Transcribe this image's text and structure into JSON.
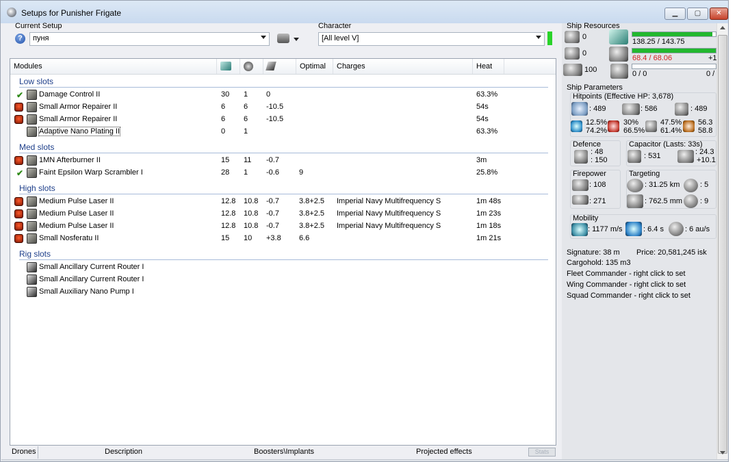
{
  "window": {
    "title": "Setups for Punisher Frigate"
  },
  "setup": {
    "label": "Current Setup",
    "value": "пуня"
  },
  "character": {
    "label": "Character",
    "value": "[All level V]"
  },
  "modules": {
    "columns": [
      "Modules",
      "Optimal",
      "Charges",
      "Heat"
    ],
    "sections": [
      {
        "name": "Low slots",
        "items": [
          {
            "state": "check",
            "name": "Damage Control II",
            "c1": "30",
            "c2": "1",
            "c3": "0",
            "optimal": "",
            "charge": "",
            "heat": "63.3%"
          },
          {
            "state": "fire",
            "name": "Small Armor Repairer II",
            "c1": "6",
            "c2": "6",
            "c3": "-10.5",
            "optimal": "",
            "charge": "",
            "heat": "54s"
          },
          {
            "state": "fire",
            "name": "Small Armor Repairer II",
            "c1": "6",
            "c2": "6",
            "c3": "-10.5",
            "optimal": "",
            "charge": "",
            "heat": "54s"
          },
          {
            "state": "none",
            "name": "Adaptive Nano Plating II",
            "c1": "0",
            "c2": "1",
            "c3": "",
            "optimal": "",
            "charge": "",
            "heat": "63.3%"
          }
        ]
      },
      {
        "name": "Med slots",
        "items": [
          {
            "state": "fire",
            "name": "1MN Afterburner II",
            "c1": "15",
            "c2": "11",
            "c3": "-0.7",
            "optimal": "",
            "charge": "",
            "heat": "3m"
          },
          {
            "state": "check",
            "name": "Faint Epsilon Warp Scrambler I",
            "c1": "28",
            "c2": "1",
            "c3": "-0.6",
            "optimal": "9",
            "charge": "",
            "heat": "25.8%"
          }
        ]
      },
      {
        "name": "High slots",
        "items": [
          {
            "state": "fire",
            "name": "Medium Pulse Laser II",
            "c1": "12.8",
            "c2": "10.8",
            "c3": "-0.7",
            "optimal": "3.8+2.5",
            "charge": "Imperial Navy Multifrequency S",
            "heat": "1m 48s"
          },
          {
            "state": "fire",
            "name": "Medium Pulse Laser II",
            "c1": "12.8",
            "c2": "10.8",
            "c3": "-0.7",
            "optimal": "3.8+2.5",
            "charge": "Imperial Navy Multifrequency S",
            "heat": "1m 23s"
          },
          {
            "state": "fire",
            "name": "Medium Pulse Laser II",
            "c1": "12.8",
            "c2": "10.8",
            "c3": "-0.7",
            "optimal": "3.8+2.5",
            "charge": "Imperial Navy Multifrequency S",
            "heat": "1m 18s"
          },
          {
            "state": "fire",
            "name": "Small Nosferatu II",
            "c1": "15",
            "c2": "10",
            "c3": "+3.8",
            "optimal": "6.6",
            "charge": "",
            "heat": "1m 21s"
          }
        ]
      },
      {
        "name": "Rig slots",
        "items": [
          {
            "state": "rig",
            "name": "Small Ancillary Current Router I",
            "c1": "",
            "c2": "",
            "c3": "",
            "optimal": "",
            "charge": "",
            "heat": ""
          },
          {
            "state": "rig",
            "name": "Small Ancillary Current Router I",
            "c1": "",
            "c2": "",
            "c3": "",
            "optimal": "",
            "charge": "",
            "heat": ""
          },
          {
            "state": "rig",
            "name": "Small Auxiliary Nano Pump I",
            "c1": "",
            "c2": "",
            "c3": "",
            "optimal": "",
            "charge": "",
            "heat": ""
          }
        ]
      }
    ]
  },
  "bottom_tabs": [
    "Drones",
    "Description",
    "Boosters\\Implants",
    "Projected effects",
    "Stats"
  ],
  "resources": {
    "title": "Ship Resources",
    "turret": "0",
    "launcher": "0",
    "drone_bw": "100",
    "cpu": "138.25 / 143.75",
    "cpu_fill": 0.96,
    "pg": "68.4 / 68.06",
    "pg_fill": 1.0,
    "pg_extra": "+1",
    "calib": "0 / 0",
    "calib_extra": "0 /"
  },
  "params": {
    "title": "Ship Parameters",
    "hp_title": "Hitpoints (Effective HP: 3,678)",
    "shield_hp": ": 489",
    "armor_hp": ": 586",
    "hull_hp": ": 489",
    "res": [
      "12.5%",
      "74.2%",
      "30%",
      "66.5%",
      "47.5%",
      "61.4%",
      "56.3",
      "58.8"
    ],
    "defence_title": "Defence",
    "def1": ": 48",
    "def2": ": 150",
    "cap_title": "Capacitor (Lasts: 33s)",
    "cap_amount": ": 531",
    "cap_recharge": ": 24.3",
    "cap_delta": "+10.1",
    "fire_title": "Firepower",
    "dps": ": 108",
    "volley": ": 271",
    "target_title": "Targeting",
    "range": ": 31.25 km",
    "targets": ": 5",
    "scan": ": 762.5 mm",
    "sensor": ": 9",
    "mobility_title": "Mobility",
    "speed": ": 1177 m/s",
    "align": ": 6.4 s",
    "warp": ": 6 au/s"
  },
  "misc": {
    "signature": "Signature: 38 m",
    "price": "Price: 20,581,245 isk",
    "cargo": "Cargohold: 135 m3",
    "fleet": "Fleet Commander - right click to set",
    "wing": "Wing Commander - right click to set",
    "squad": "Squad Commander - right click to set"
  }
}
